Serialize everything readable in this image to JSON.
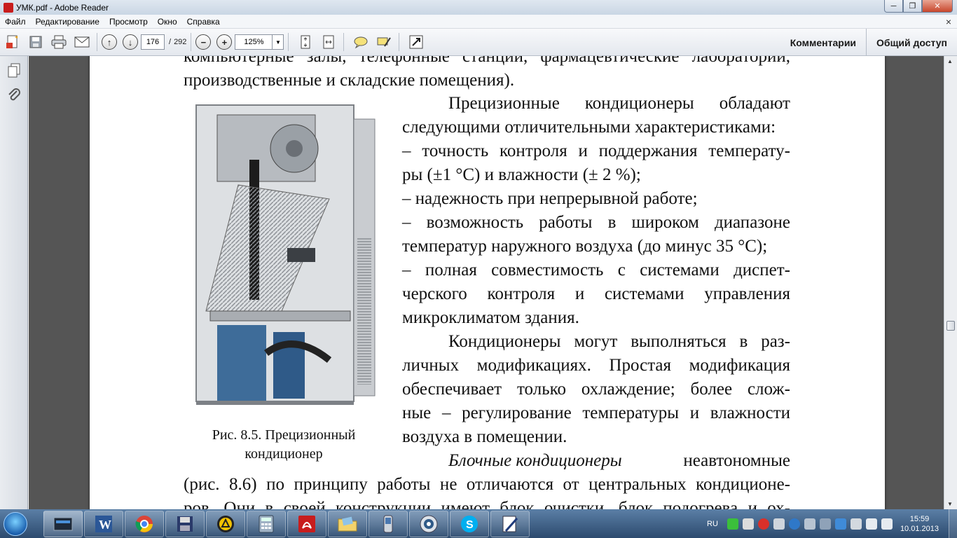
{
  "window": {
    "title": "УМК.pdf - Adobe Reader",
    "controls": {
      "minimize": "─",
      "maximize": "❐",
      "close": "✕"
    }
  },
  "menu": {
    "items": [
      "Файл",
      "Редактирование",
      "Просмотр",
      "Окно",
      "Справка"
    ],
    "close_glyph": "×"
  },
  "toolbar": {
    "page_current": "176",
    "page_separator": "/",
    "page_total": "292",
    "zoom": "125%",
    "comments_label": "Комментарии",
    "share_label": "Общий доступ"
  },
  "document": {
    "top_lines": [
      "компьютерные залы, телефонные станции, фармацевтические лаборатории,",
      "производственные и складские помещения)."
    ],
    "right_lines": [
      "Прецизионные кондиционеры обладают",
      "следующими отличительными характеристиками:",
      "– точность контроля и поддержания температу-",
      "ры (±1 °С) и влажности (± 2 %);",
      "– надежность при непрерывной работе;",
      "– возможность работы в широком диапазоне",
      "температур наружного воздуха (до минус 35 °С);",
      "– полная совместимость с системами диспет-",
      "черского контроля и системами управления",
      "микроклиматом здания.",
      "Кондиционеры могут выполняться в раз-",
      "личных модификациях. Простая модификация",
      "обеспечивает только охлаждение; более слож-",
      "ные – регулирование температуры и влажности",
      "воздуха в помещении."
    ],
    "blocks_italic": "Блочные кондиционеры",
    "blocks_rest": "неавтономные",
    "bottom_lines": [
      "(рис. 8.6) по принципу работы не отличаются от центральных кондиционе-",
      "ров. Они в своей конструкции имеют блок очистки, блок подогрева и ох-"
    ],
    "caption_line1": "Рис. 8.5. Прецизионный",
    "caption_line2": "кондиционер"
  },
  "taskbar": {
    "language": "RU",
    "time": "15:59",
    "date": "10.01.2013",
    "apps": [
      "explorer-icon",
      "word-icon",
      "chrome-icon",
      "floppy-icon",
      "daemon-tools-icon",
      "calculator-icon",
      "adobe-reader-icon",
      "folder-icon",
      "phone-icon",
      "media-player-icon",
      "skype-icon",
      "notepad-icon"
    ]
  },
  "colors": {
    "doc_background": "#555555",
    "taskbar": "#2c4a6e",
    "acrobat_red": "#c81d1d"
  }
}
